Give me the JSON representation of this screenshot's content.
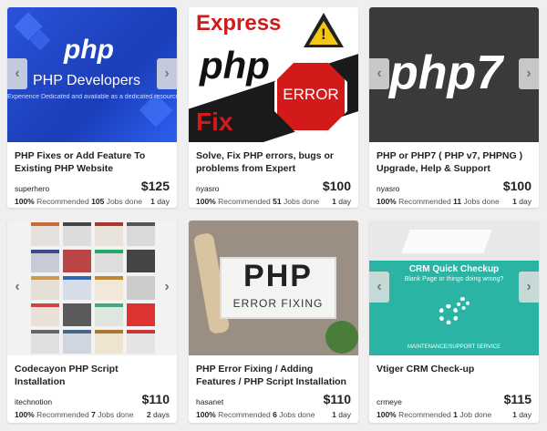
{
  "cards": [
    {
      "title": "PHP Fixes or Add Feature To Existing PHP Website",
      "seller": "superhero",
      "price": "$125",
      "recommended": "100%",
      "recommended_label": "Recommended",
      "jobs": "105",
      "jobs_label": "Jobs done",
      "days": "1",
      "days_label": "day",
      "thumb_text": [
        "php",
        "PHP Developers",
        "Experience Dedicated and available as a dedicated resource"
      ]
    },
    {
      "title": "Solve, Fix PHP errors, bugs or problems from Expert",
      "seller": "nyasro",
      "price": "$100",
      "recommended": "100%",
      "recommended_label": "Recommended",
      "jobs": "51",
      "jobs_label": "Jobs done",
      "days": "1",
      "days_label": "day",
      "thumb_text": [
        "Express",
        "php",
        "Fix",
        "ERROR"
      ]
    },
    {
      "title": "PHP or PHP7 ( PHP v7, PHPNG ) Upgrade, Help & Support",
      "seller": "nyasro",
      "price": "$100",
      "recommended": "100%",
      "recommended_label": "Recommended",
      "jobs": "11",
      "jobs_label": "Jobs done",
      "days": "1",
      "days_label": "day",
      "thumb_text": [
        "php7"
      ]
    },
    {
      "title": "Codecayon PHP Script Installation",
      "seller": "itechnotion",
      "price": "$110",
      "recommended": "100%",
      "recommended_label": "Recommended",
      "jobs": "7",
      "jobs_label": "Jobs done",
      "days": "2",
      "days_label": "days",
      "thumb_text": []
    },
    {
      "title": "PHP Error Fixing / Adding Features / PHP Script Installation",
      "seller": "hasanet",
      "price": "$110",
      "recommended": "100%",
      "recommended_label": "Recommended",
      "jobs": "6",
      "jobs_label": "Jobs done",
      "days": "1",
      "days_label": "day",
      "thumb_text": [
        "PHP",
        "ERROR FIXING"
      ]
    },
    {
      "title": "Vtiger CRM Check-up",
      "seller": "crmeye",
      "price": "$115",
      "recommended": "100%",
      "recommended_label": "Recommended",
      "jobs": "1",
      "jobs_label": "Job done",
      "days": "1",
      "days_label": "day",
      "thumb_text": [
        "CRM Quick Checkup",
        "Blank Page or things doing wrong?",
        "MAINTENANCE/SUPPORT SERVICE"
      ]
    }
  ],
  "colors": {
    "php_blue": "#2a55d8",
    "crm_teal": "#2bb3a3",
    "stop_red": "#d31a1a"
  },
  "icons": {
    "prev": "chevron-left-icon",
    "next": "chevron-right-icon",
    "prev_glyph": "‹",
    "next_glyph": "›"
  }
}
